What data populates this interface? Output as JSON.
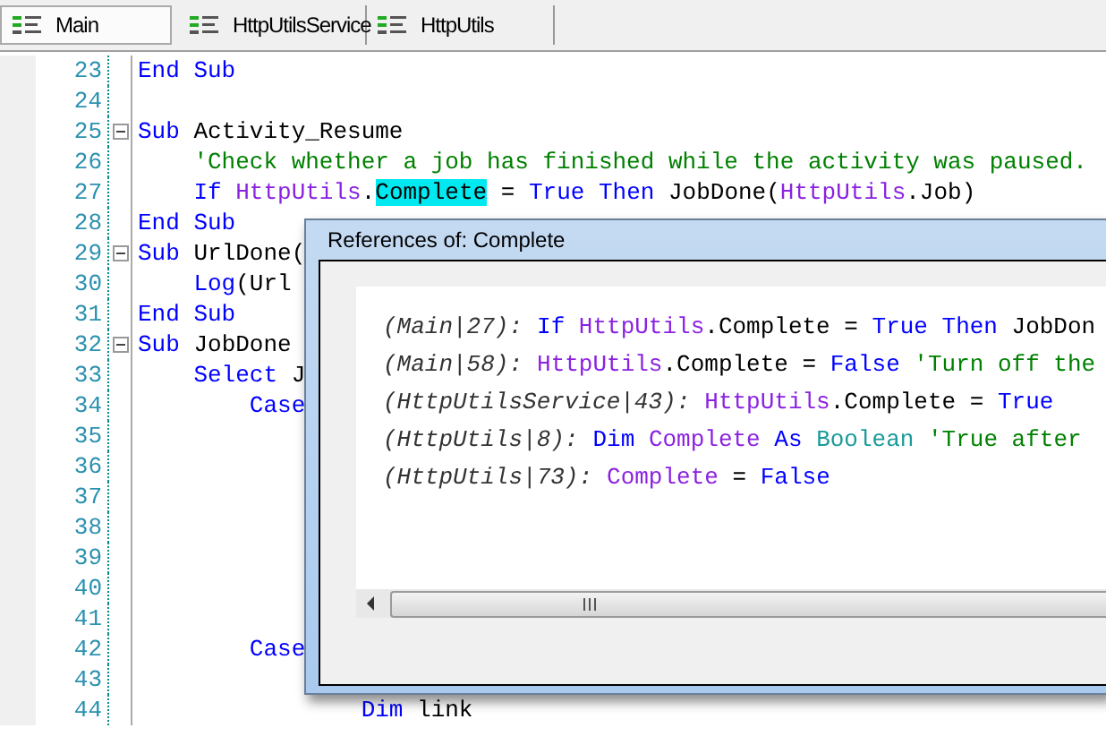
{
  "tabs": [
    {
      "label": "Main",
      "selected": true
    },
    {
      "label": "HttpUtilsService",
      "selected": false
    },
    {
      "label": "HttpUtils",
      "selected": false
    }
  ],
  "editor": {
    "lines": [
      {
        "number": "23",
        "collapsible": false,
        "tokens": [
          {
            "kind": "keyword",
            "t": "End Sub"
          }
        ]
      },
      {
        "number": "24",
        "collapsible": false
      },
      {
        "number": "25",
        "collapsible": true,
        "tokens": [
          {
            "kind": "keyword",
            "t": "Sub "
          },
          {
            "kind": "plain",
            "t": "Activity_Resume"
          }
        ]
      },
      {
        "number": "26",
        "collapsible": false,
        "tokens": [
          {
            "kind": "comment",
            "t": "    'Check whether a job has finished while the activity was paused."
          }
        ]
      },
      {
        "number": "27",
        "collapsible": false,
        "tokens": [
          {
            "kind": "keyword",
            "t": "    If "
          },
          {
            "kind": "class",
            "t": "HttpUtils"
          },
          {
            "kind": "plain",
            "t": "."
          },
          {
            "kind": "highlight",
            "t": "Complete"
          },
          {
            "kind": "plain",
            "t": " = "
          },
          {
            "kind": "keyword",
            "t": "True Then "
          },
          {
            "kind": "plain",
            "t": "JobDone("
          },
          {
            "kind": "class",
            "t": "HttpUtils"
          },
          {
            "kind": "plain",
            "t": ".Job)"
          }
        ]
      },
      {
        "number": "28",
        "collapsible": false,
        "tokens": [
          {
            "kind": "keyword",
            "t": "End Sub"
          }
        ]
      },
      {
        "number": "29",
        "collapsible": true,
        "tokens": [
          {
            "kind": "keyword",
            "t": "Sub "
          },
          {
            "kind": "plain",
            "t": "UrlDone("
          }
        ]
      },
      {
        "number": "30",
        "collapsible": false,
        "tokens": [
          {
            "kind": "keyword",
            "t": "    Log"
          },
          {
            "kind": "plain",
            "t": "(Url"
          }
        ]
      },
      {
        "number": "31",
        "collapsible": false,
        "tokens": [
          {
            "kind": "keyword",
            "t": "End Sub"
          }
        ]
      },
      {
        "number": "32",
        "collapsible": true,
        "tokens": [
          {
            "kind": "keyword",
            "t": "Sub "
          },
          {
            "kind": "plain",
            "t": "JobDone"
          }
        ]
      },
      {
        "number": "33",
        "collapsible": false,
        "tokens": [
          {
            "kind": "keyword",
            "t": "    Select "
          },
          {
            "kind": "plain",
            "t": "J"
          }
        ]
      },
      {
        "number": "34",
        "collapsible": false,
        "tokens": [
          {
            "kind": "keyword",
            "t": "        Case"
          }
        ]
      },
      {
        "number": "35",
        "collapsible": false
      },
      {
        "number": "36",
        "collapsible": false
      },
      {
        "number": "37",
        "collapsible": false
      },
      {
        "number": "38",
        "collapsible": false
      },
      {
        "number": "39",
        "collapsible": false
      },
      {
        "number": "40",
        "collapsible": false
      },
      {
        "number": "41",
        "collapsible": false
      },
      {
        "number": "42",
        "collapsible": false,
        "tokens": [
          {
            "kind": "keyword",
            "t": "        Case"
          }
        ]
      },
      {
        "number": "43",
        "collapsible": false
      },
      {
        "number": "44",
        "collapsible": false,
        "tokens": [
          {
            "kind": "keyword",
            "t": "                Dim "
          },
          {
            "kind": "plain",
            "t": "link"
          }
        ]
      }
    ]
  },
  "dialog": {
    "title": "References of: Complete",
    "references": [
      {
        "location": "(Main|27):",
        "tokens": [
          {
            "kind": "keyword",
            "t": "If "
          },
          {
            "kind": "class",
            "t": "HttpUtils"
          },
          {
            "kind": "plain",
            "t": ".Complete = "
          },
          {
            "kind": "keyword",
            "t": "True Then "
          },
          {
            "kind": "plain",
            "t": "JobDon"
          }
        ]
      },
      {
        "location": "(Main|58):",
        "tokens": [
          {
            "kind": "class",
            "t": "HttpUtils"
          },
          {
            "kind": "plain",
            "t": ".Complete = "
          },
          {
            "kind": "keyword",
            "t": "False "
          },
          {
            "kind": "comment",
            "t": "'Turn off the"
          }
        ]
      },
      {
        "location": "(HttpUtilsService|43):",
        "tokens": [
          {
            "kind": "class",
            "t": "HttpUtils"
          },
          {
            "kind": "plain",
            "t": ".Complete = "
          },
          {
            "kind": "keyword",
            "t": "True"
          }
        ]
      },
      {
        "location": "(HttpUtils|8):",
        "tokens": [
          {
            "kind": "keyword",
            "t": "Dim "
          },
          {
            "kind": "class",
            "t": "Complete "
          },
          {
            "kind": "keyword",
            "t": "As "
          },
          {
            "kind": "type",
            "t": "Boolean "
          },
          {
            "kind": "comment",
            "t": "'True after"
          }
        ]
      },
      {
        "location": "(HttpUtils|73):",
        "tokens": [
          {
            "kind": "class",
            "t": "Complete"
          },
          {
            "kind": "plain",
            "t": " = "
          },
          {
            "kind": "keyword",
            "t": "False"
          }
        ]
      }
    ]
  }
}
